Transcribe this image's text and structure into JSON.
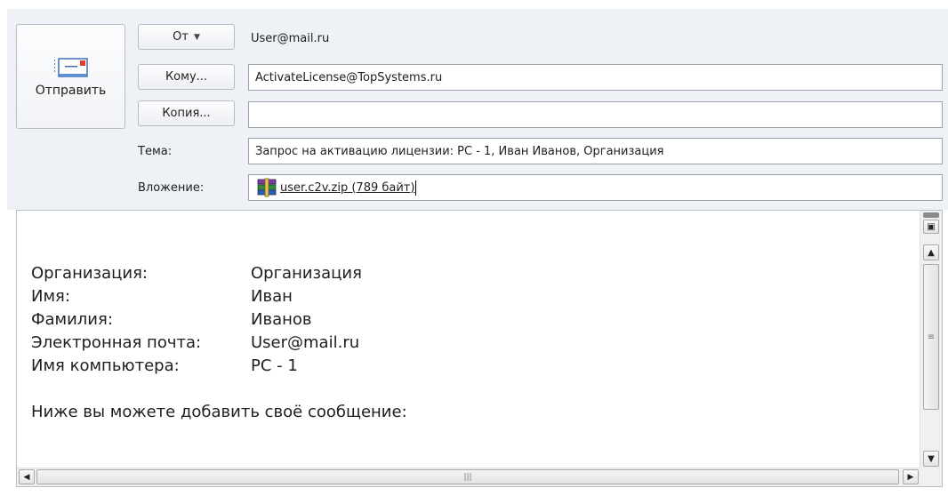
{
  "compose": {
    "send_label": "Отправить",
    "from_label": "От",
    "from_value": "User@mail.ru",
    "to_label": "Кому...",
    "to_value": "ActivateLicense@TopSystems.ru",
    "cc_label": "Копия...",
    "cc_value": "",
    "subject_label": "Тема:",
    "subject_value": "Запрос на активацию лицензии: PC - 1, Иван Иванов, Организация",
    "attachment_label": "Вложение:",
    "attachment_value": "user.c2v.zip (789 байт)"
  },
  "body": {
    "rows": [
      {
        "key": "Организация:",
        "value": "Организация"
      },
      {
        "key": "Имя:",
        "value": "Иван"
      },
      {
        "key": "Фамилия:",
        "value": "Иванов"
      },
      {
        "key": "Электронная почта:",
        "value": "User@mail.ru"
      },
      {
        "key": "Имя компьютера:",
        "value": "PC - 1"
      }
    ],
    "note": "Ниже вы можете добавить своё сообщение:"
  },
  "icons": {
    "send": "envelope-send-icon",
    "caret": "chevron-down-icon",
    "attachment": "winrar-archive-icon"
  }
}
